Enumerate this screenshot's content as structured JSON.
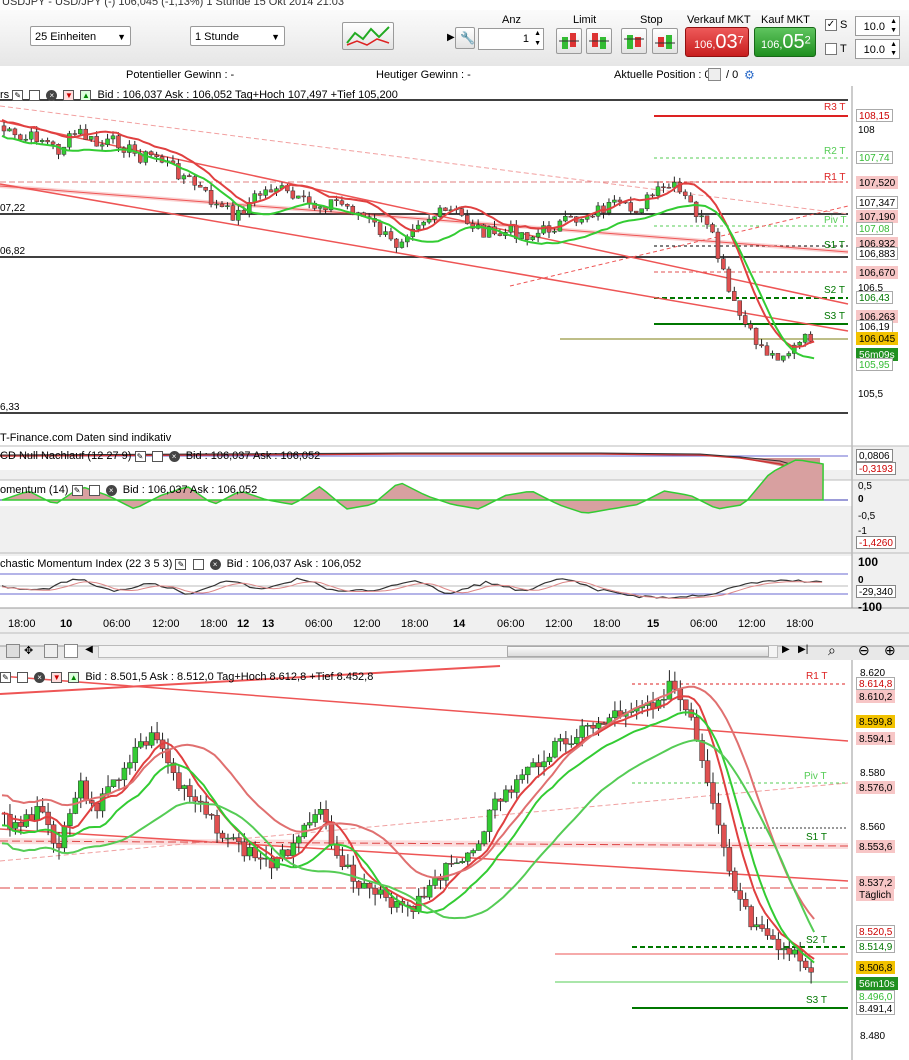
{
  "window": {
    "title": "USDJPY - USD/JPY (-)     106,045 (-1,13%)     1 Stunde    15 Okt 2014 21:03"
  },
  "toolbar": {
    "units_select": "25 Einheiten",
    "period_select": "1 Stunde",
    "labels": {
      "anz": "Anz",
      "limit": "Limit",
      "stop": "Stop",
      "verkauf": "Verkauf MKT",
      "kauf": "Kauf MKT"
    },
    "anz_value": "1",
    "sell_price": {
      "prefix": "106,",
      "big": "03",
      "sup": "7"
    },
    "buy_price": {
      "prefix": "106,",
      "big": "05",
      "sup": "2"
    },
    "s_label": "S",
    "t_label": "T",
    "s_value": "10.0",
    "t_value": "10.0",
    "s_checked": true,
    "t_checked": false
  },
  "info": {
    "potential": "Potentieller Gewinn : -",
    "today": "Heutiger Gewinn : -",
    "position": "Aktuelle Position : 0",
    "position_suffix": "/ 0"
  },
  "chart1": {
    "header_prefix": "rs",
    "header": "Bid : 106,037 Ask : 106,052 Tag+Hoch 107,497 +Tief 105,200",
    "source_note": "T-Finance.com  Daten sind indikativ",
    "left_labels": [
      "07,22",
      "06,82",
      "6,33"
    ],
    "axis": [
      "108",
      "106,5",
      "105,5"
    ],
    "levels": [
      "R3 T",
      "R2 T",
      "R1 T",
      "Piv T",
      "S1 T",
      "S2 T",
      "S3 T"
    ],
    "tags": [
      {
        "text": "108,15",
        "color": "#cc0000",
        "bg": "#ffffff"
      },
      {
        "text": "107,74",
        "color": "#33bb33",
        "bg": "#ffffff"
      },
      {
        "text": "107,520",
        "color": "#000000",
        "bg": "#f7c6c6"
      },
      {
        "text": "107,347",
        "color": "#000000",
        "bg": "#ffffff"
      },
      {
        "text": "107,190",
        "color": "#000000",
        "bg": "#f7c6c6"
      },
      {
        "text": "107,08",
        "color": "#33bb33",
        "bg": "#ffffff"
      },
      {
        "text": "106,932",
        "color": "#000000",
        "bg": "#f7c6c6"
      },
      {
        "text": "106,883",
        "color": "#000000",
        "bg": "#ffffff"
      },
      {
        "text": "106,670",
        "color": "#000000",
        "bg": "#f7c6c6"
      },
      {
        "text": "106,43",
        "color": "#007700",
        "bg": "#ffffff"
      },
      {
        "text": "106,263",
        "color": "#000000",
        "bg": "#f7c6c6"
      },
      {
        "text": "106,19",
        "color": "#000000",
        "bg": "#ffffff"
      },
      {
        "text": "106,045",
        "color": "#000000",
        "bg": "#f2c200"
      },
      {
        "text": "56m09s",
        "color": "#ffffff",
        "bg": "#209020"
      },
      {
        "text": "105,95",
        "color": "#33bb33",
        "bg": "#ffffff"
      }
    ]
  },
  "macd": {
    "title": "CD Null Nachlauf (12 27 9)",
    "header": "Bid : 106,037 Ask : 106,052",
    "tags": [
      {
        "text": "0,0806",
        "color": "#000000"
      },
      {
        "text": "-0,3193",
        "color": "#cc0000"
      }
    ]
  },
  "momentum": {
    "title": "omentum (14)",
    "header": "Bid : 106,037 Ask : 106,052",
    "axis": [
      "0,5",
      "0",
      "-0,5",
      "-1"
    ],
    "tag": "-1,4260"
  },
  "smi": {
    "title": "chastic Momentum Index (22 3 5 3)",
    "header": "Bid : 106,037 Ask : 106,052",
    "axis": [
      "100",
      "0",
      "-100"
    ],
    "tag": "-29,340"
  },
  "time_axis": {
    "labels": [
      "18:00",
      "10",
      "06:00",
      "12:00",
      "18:00",
      "12",
      "13",
      "06:00",
      "12:00",
      "18:00",
      "14",
      "06:00",
      "12:00",
      "18:00",
      "15",
      "06:00",
      "12:00",
      "18:00"
    ],
    "bold": [
      "10",
      "12",
      "13",
      "14",
      "15"
    ]
  },
  "chart2": {
    "header": "Bid : 8.501,5 Ask : 8.512,0 Tag+Hoch 8.612,8 +Tief 8.452,8",
    "axis": [
      "8.620",
      "8.580",
      "8.560",
      "8.480"
    ],
    "levels": [
      "R1 T",
      "Piv T",
      "S1 T",
      "S2 T",
      "S3 T"
    ],
    "tags": [
      {
        "text": "8.614,8",
        "color": "#cc0000",
        "bg": "#ffffff"
      },
      {
        "text": "8.610,2",
        "color": "#000000",
        "bg": "#f7c6c6"
      },
      {
        "text": "8.599,8",
        "color": "#000000",
        "bg": "#f2c200"
      },
      {
        "text": "8.594,1",
        "color": "#000000",
        "bg": "#f7c6c6"
      },
      {
        "text": "8.576,0",
        "color": "#000000",
        "bg": "#f7c6c6"
      },
      {
        "text": "8.553,6",
        "color": "#000000",
        "bg": "#f7c6c6"
      },
      {
        "text": "8.537,2",
        "color": "#000000",
        "bg": "#f7c6c6"
      },
      {
        "text": "Täglich",
        "color": "#000000",
        "bg": "#f7c6c6"
      },
      {
        "text": "8.520,5",
        "color": "#cc0000",
        "bg": "#ffffff"
      },
      {
        "text": "8.514,9",
        "color": "#007700",
        "bg": "#ffffff"
      },
      {
        "text": "8.506,8",
        "color": "#000000",
        "bg": "#f2c200"
      },
      {
        "text": "56m10s",
        "color": "#ffffff",
        "bg": "#209020"
      },
      {
        "text": "8.496,0",
        "color": "#33bb33",
        "bg": "#ffffff"
      },
      {
        "text": "8.491,4",
        "color": "#000000",
        "bg": "#ffffff"
      }
    ]
  },
  "colors": {
    "bull": "#33cc33",
    "bear": "#e05050",
    "pivot_red": "#dd2222",
    "pivot_green": "#33bb33"
  }
}
